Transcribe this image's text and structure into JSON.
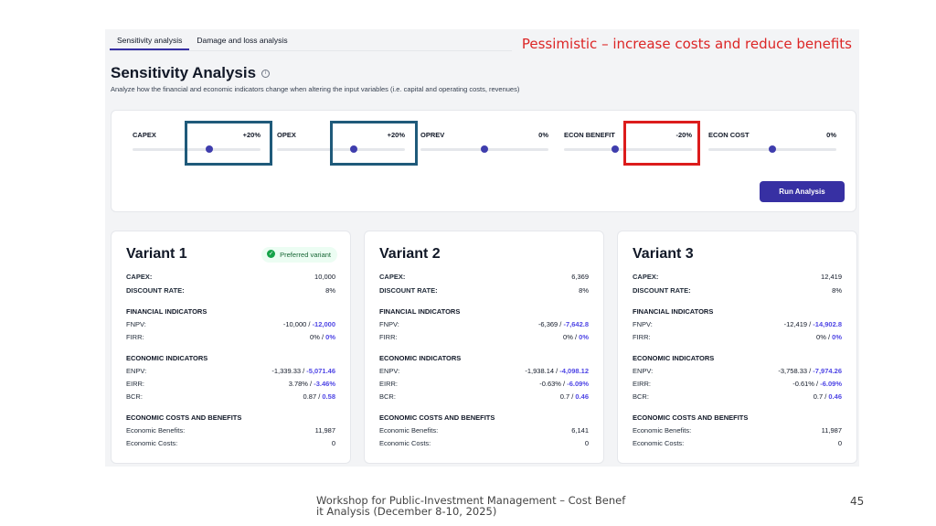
{
  "tabs": [
    {
      "label": "Sensitivity analysis",
      "active": true
    },
    {
      "label": "Damage and loss analysis",
      "active": false
    }
  ],
  "annotation": "Pessimistic – increase costs and reduce benefits",
  "page": {
    "title": "Sensitivity Analysis",
    "subtitle": "Analyze how the financial and economic indicators change when altering the input variables (i.e. capital and operating costs, revenues)"
  },
  "sliders": [
    {
      "label": "CAPEX",
      "value": "+20%",
      "level_pct": 60
    },
    {
      "label": "OPEX",
      "value": "+20%",
      "level_pct": 60
    },
    {
      "label": "OPREV",
      "value": "0%",
      "level_pct": 50
    },
    {
      "label": "ECON BENEFIT",
      "value": "-20%",
      "level_pct": 40
    },
    {
      "label": "ECON COST",
      "value": "0%",
      "level_pct": 50
    }
  ],
  "run_button": "Run Analysis",
  "labels": {
    "capex": "CAPEX:",
    "discount": "DISCOUNT RATE:",
    "fin": "FINANCIAL INDICATORS",
    "fnpv": "FNPV:",
    "firr": "FIRR:",
    "eco": "ECONOMIC INDICATORS",
    "enpv": "ENPV:",
    "eirr": "EIRR:",
    "bcr": "BCR:",
    "ecb": "ECONOMIC COSTS AND BENEFITS",
    "benefits": "Economic Benefits:",
    "costs": "Economic Costs:"
  },
  "variants": [
    {
      "title": "Variant 1",
      "badge": "Preferred variant",
      "capex": "10,000",
      "discount": "8%",
      "fnpv_old": "-10,000 /",
      "fnpv_new": "-12,000",
      "firr_old": "0% /",
      "firr_new": "0%",
      "enpv_old": "-1,339.33 /",
      "enpv_new": "-5,071.46",
      "eirr_old": "3.78% /",
      "eirr_new": "-3.46%",
      "bcr_old": "0.87 /",
      "bcr_new": "0.58",
      "benefits": "11,987",
      "costs": "0"
    },
    {
      "title": "Variant 2",
      "badge": "",
      "capex": "6,369",
      "discount": "8%",
      "fnpv_old": "-6,369 /",
      "fnpv_new": "-7,642.8",
      "firr_old": "0% /",
      "firr_new": "0%",
      "enpv_old": "-1,938.14 /",
      "enpv_new": "-4,098.12",
      "eirr_old": "-0.63% /",
      "eirr_new": "-6.09%",
      "bcr_old": "0.7 /",
      "bcr_new": "0.46",
      "benefits": "6,141",
      "costs": "0"
    },
    {
      "title": "Variant 3",
      "badge": "",
      "capex": "12,419",
      "discount": "8%",
      "fnpv_old": "-12,419 /",
      "fnpv_new": "-14,902.8",
      "firr_old": "0% /",
      "firr_new": "0%",
      "enpv_old": "-3,758.33 /",
      "enpv_new": "-7,974.26",
      "eirr_old": "-0.61% /",
      "eirr_new": "-6.09%",
      "bcr_old": "0.7 /",
      "bcr_new": "0.46",
      "benefits": "11,987",
      "costs": "0"
    }
  ],
  "footer": "Workshop for Public-Investment Management – Cost Benefit Analysis (December 8-10, 2025)",
  "page_number": "45"
}
